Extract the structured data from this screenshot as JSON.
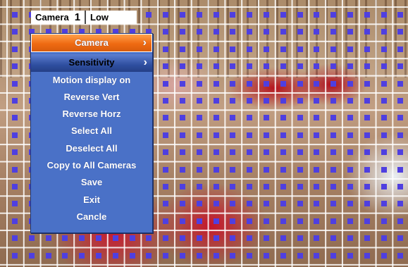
{
  "topbar": {
    "camera_label": "Camera",
    "camera_number": "1",
    "sensitivity_value": "Low"
  },
  "menu": {
    "items": [
      {
        "label": "Camera",
        "has_submenu": true
      },
      {
        "label": "Sensitivity",
        "has_submenu": true
      },
      {
        "label": "Motion display on"
      },
      {
        "label": "Reverse Vert"
      },
      {
        "label": "Reverse Horz"
      },
      {
        "label": "Select All"
      },
      {
        "label": "Deselect All"
      },
      {
        "label": "Copy to All Cameras"
      },
      {
        "label": "Save"
      },
      {
        "label": "Exit"
      },
      {
        "label": "Cancle"
      }
    ],
    "selected_index": 0,
    "submenu_arrow": "chevron-right-icon"
  },
  "colors": {
    "menu_bg": "#4a71c7",
    "highlight": "#ef6a12",
    "cell_marker": "#4f3fe0",
    "grid_line": "#ffffff"
  }
}
